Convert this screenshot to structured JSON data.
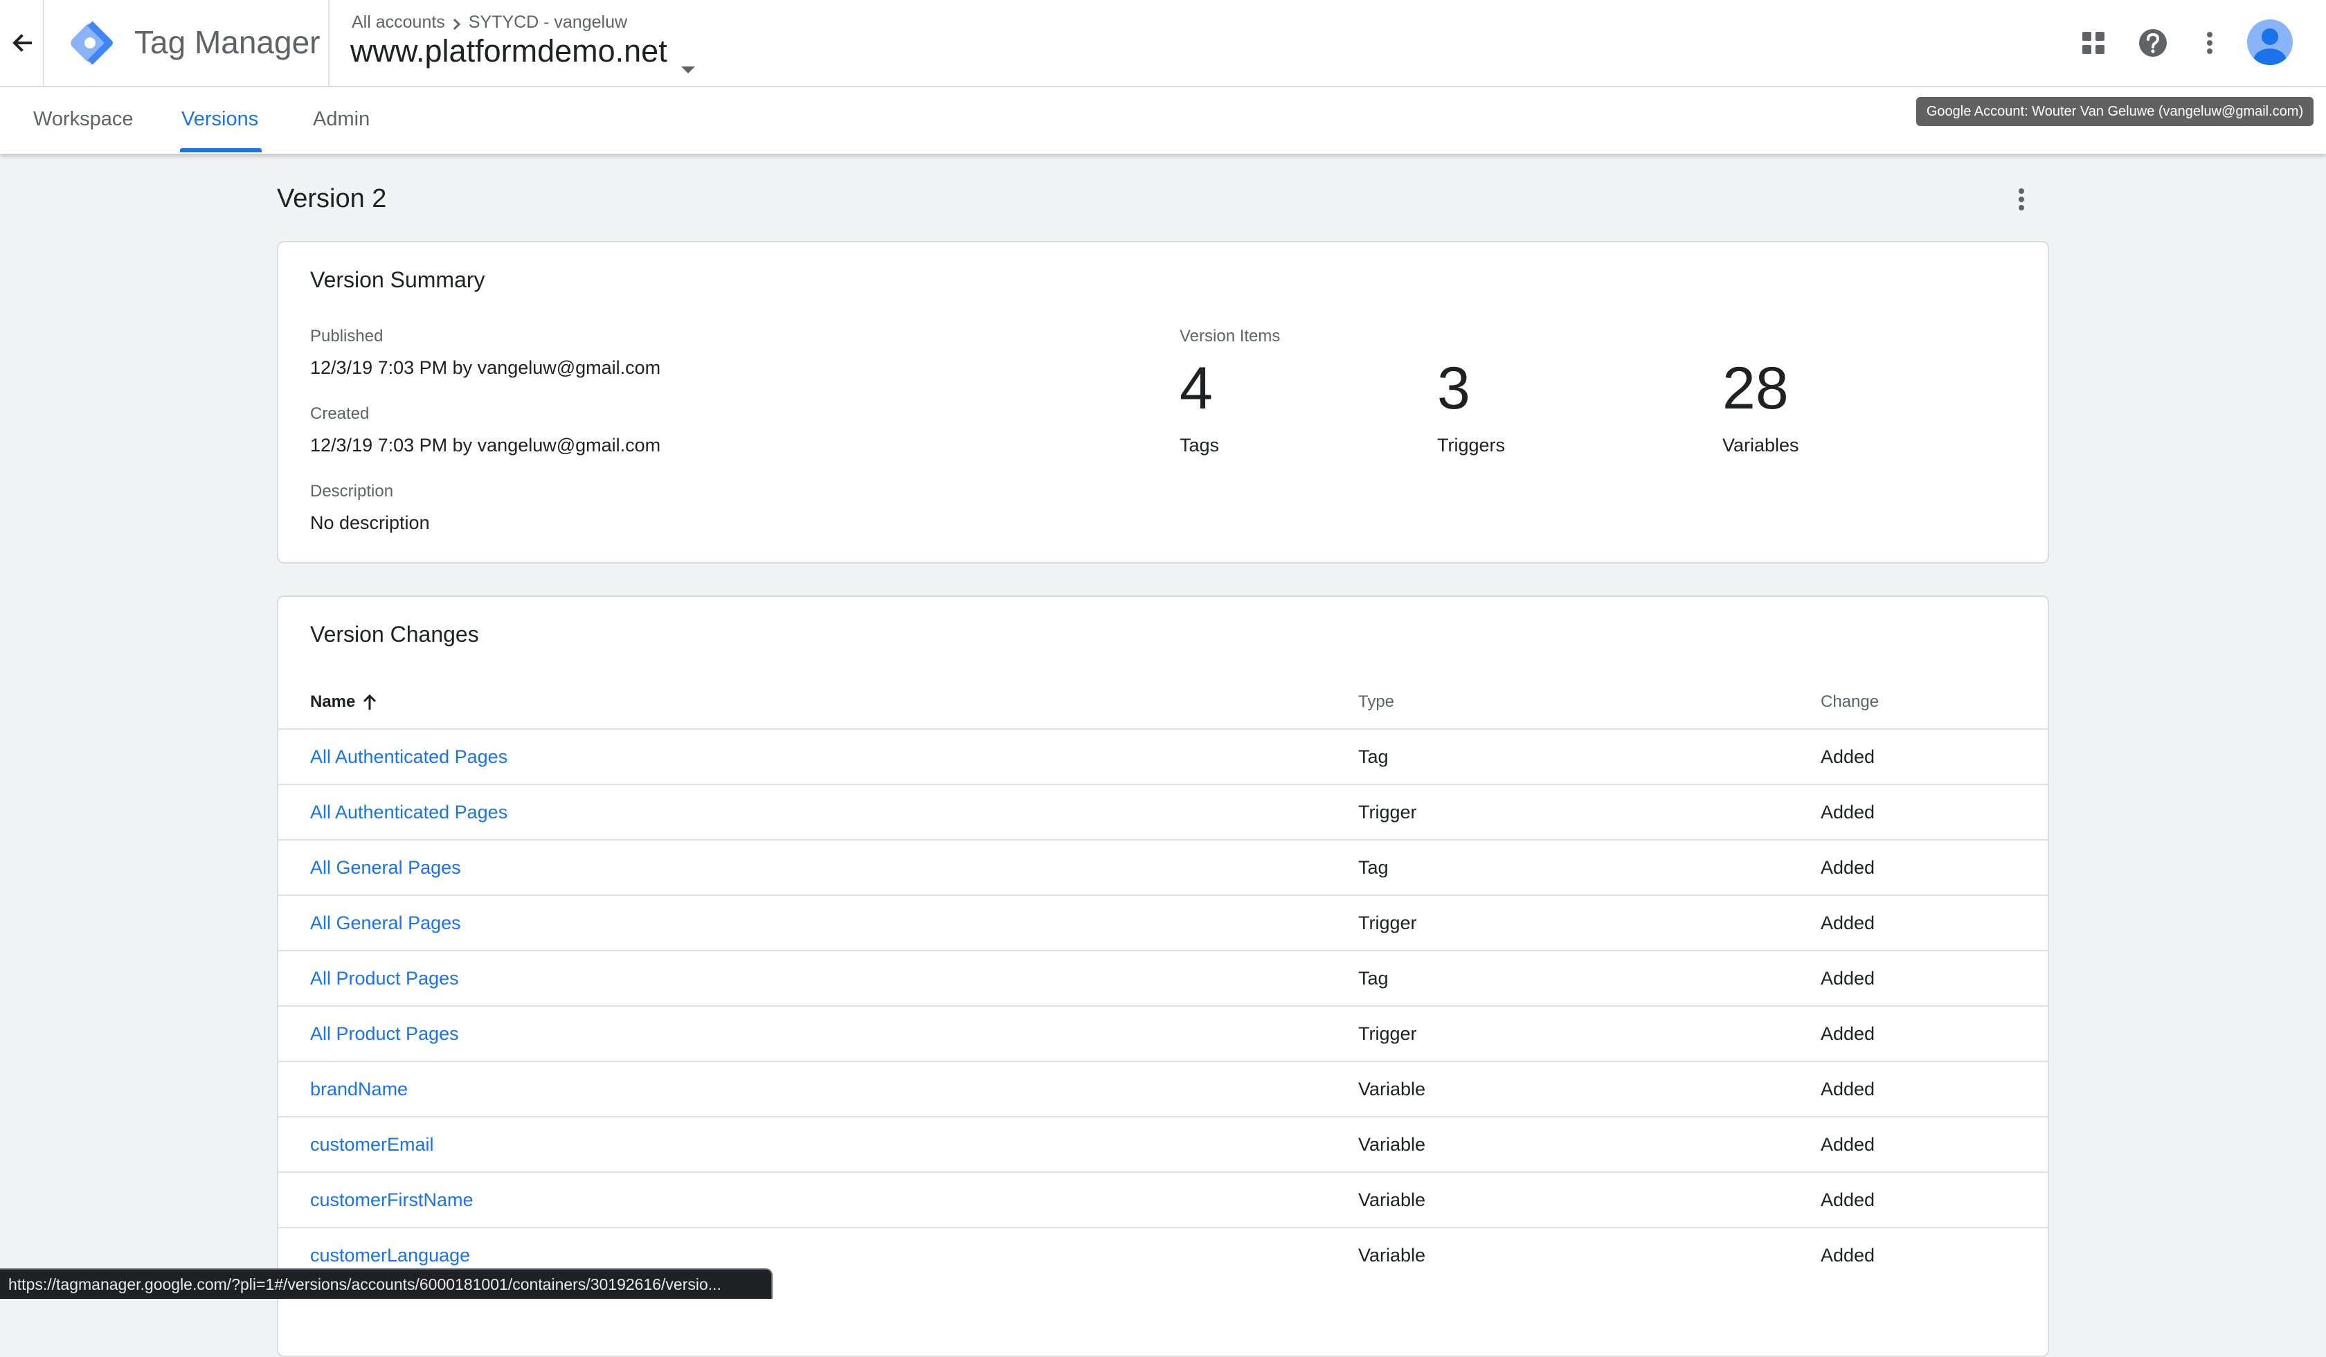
{
  "header": {
    "app_title": "Tag Manager",
    "breadcrumb": [
      "All accounts",
      "SYTYCD - vangeluw"
    ],
    "container_name": "www.platformdemo.net",
    "icons": [
      "arrow-back-icon",
      "tag-manager-logo",
      "apps-grid-icon",
      "help-icon",
      "more-vert-icon",
      "account-avatar"
    ]
  },
  "tabs": [
    {
      "label": "Workspace",
      "active": false
    },
    {
      "label": "Versions",
      "active": true
    },
    {
      "label": "Admin",
      "active": false
    }
  ],
  "tooltip": "Google Account: Wouter Van Geluwe (vangeluw@gmail.com)",
  "page_title": "Version 2",
  "summary": {
    "title": "Version Summary",
    "published_label": "Published",
    "published_value": "12/3/19 7:03 PM by vangeluw@gmail.com",
    "created_label": "Created",
    "created_value": "12/3/19 7:03 PM by vangeluw@gmail.com",
    "description_label": "Description",
    "description_value": "No description",
    "items_label": "Version Items",
    "items": [
      {
        "count": "4",
        "label": "Tags"
      },
      {
        "count": "3",
        "label": "Triggers"
      },
      {
        "count": "28",
        "label": "Variables"
      }
    ]
  },
  "changes": {
    "title": "Version Changes",
    "columns": {
      "name": "Name",
      "type": "Type",
      "change": "Change"
    },
    "sort": "name ascending",
    "rows": [
      {
        "name": "All Authenticated Pages",
        "type": "Tag",
        "change": "Added"
      },
      {
        "name": "All Authenticated Pages",
        "type": "Trigger",
        "change": "Added"
      },
      {
        "name": "All General Pages",
        "type": "Tag",
        "change": "Added"
      },
      {
        "name": "All General Pages",
        "type": "Trigger",
        "change": "Added"
      },
      {
        "name": "All Product Pages",
        "type": "Tag",
        "change": "Added"
      },
      {
        "name": "All Product Pages",
        "type": "Trigger",
        "change": "Added"
      },
      {
        "name": "brandName",
        "type": "Variable",
        "change": "Added"
      },
      {
        "name": "customerEmail",
        "type": "Variable",
        "change": "Added"
      },
      {
        "name": "customerFirstName",
        "type": "Variable",
        "change": "Added"
      },
      {
        "name": "customerLanguage",
        "type": "Variable",
        "change": "Added"
      }
    ]
  },
  "status_url": "https://tagmanager.google.com/?pli=1#/versions/accounts/6000181001/containers/30192616/versio...",
  "colors": {
    "accent": "#1a73e8",
    "background": "#f1f3f4",
    "text": "#202124",
    "secondary_text": "#5f6368",
    "logo_light": "#8ab4f8",
    "logo_dark": "#4285f4"
  }
}
